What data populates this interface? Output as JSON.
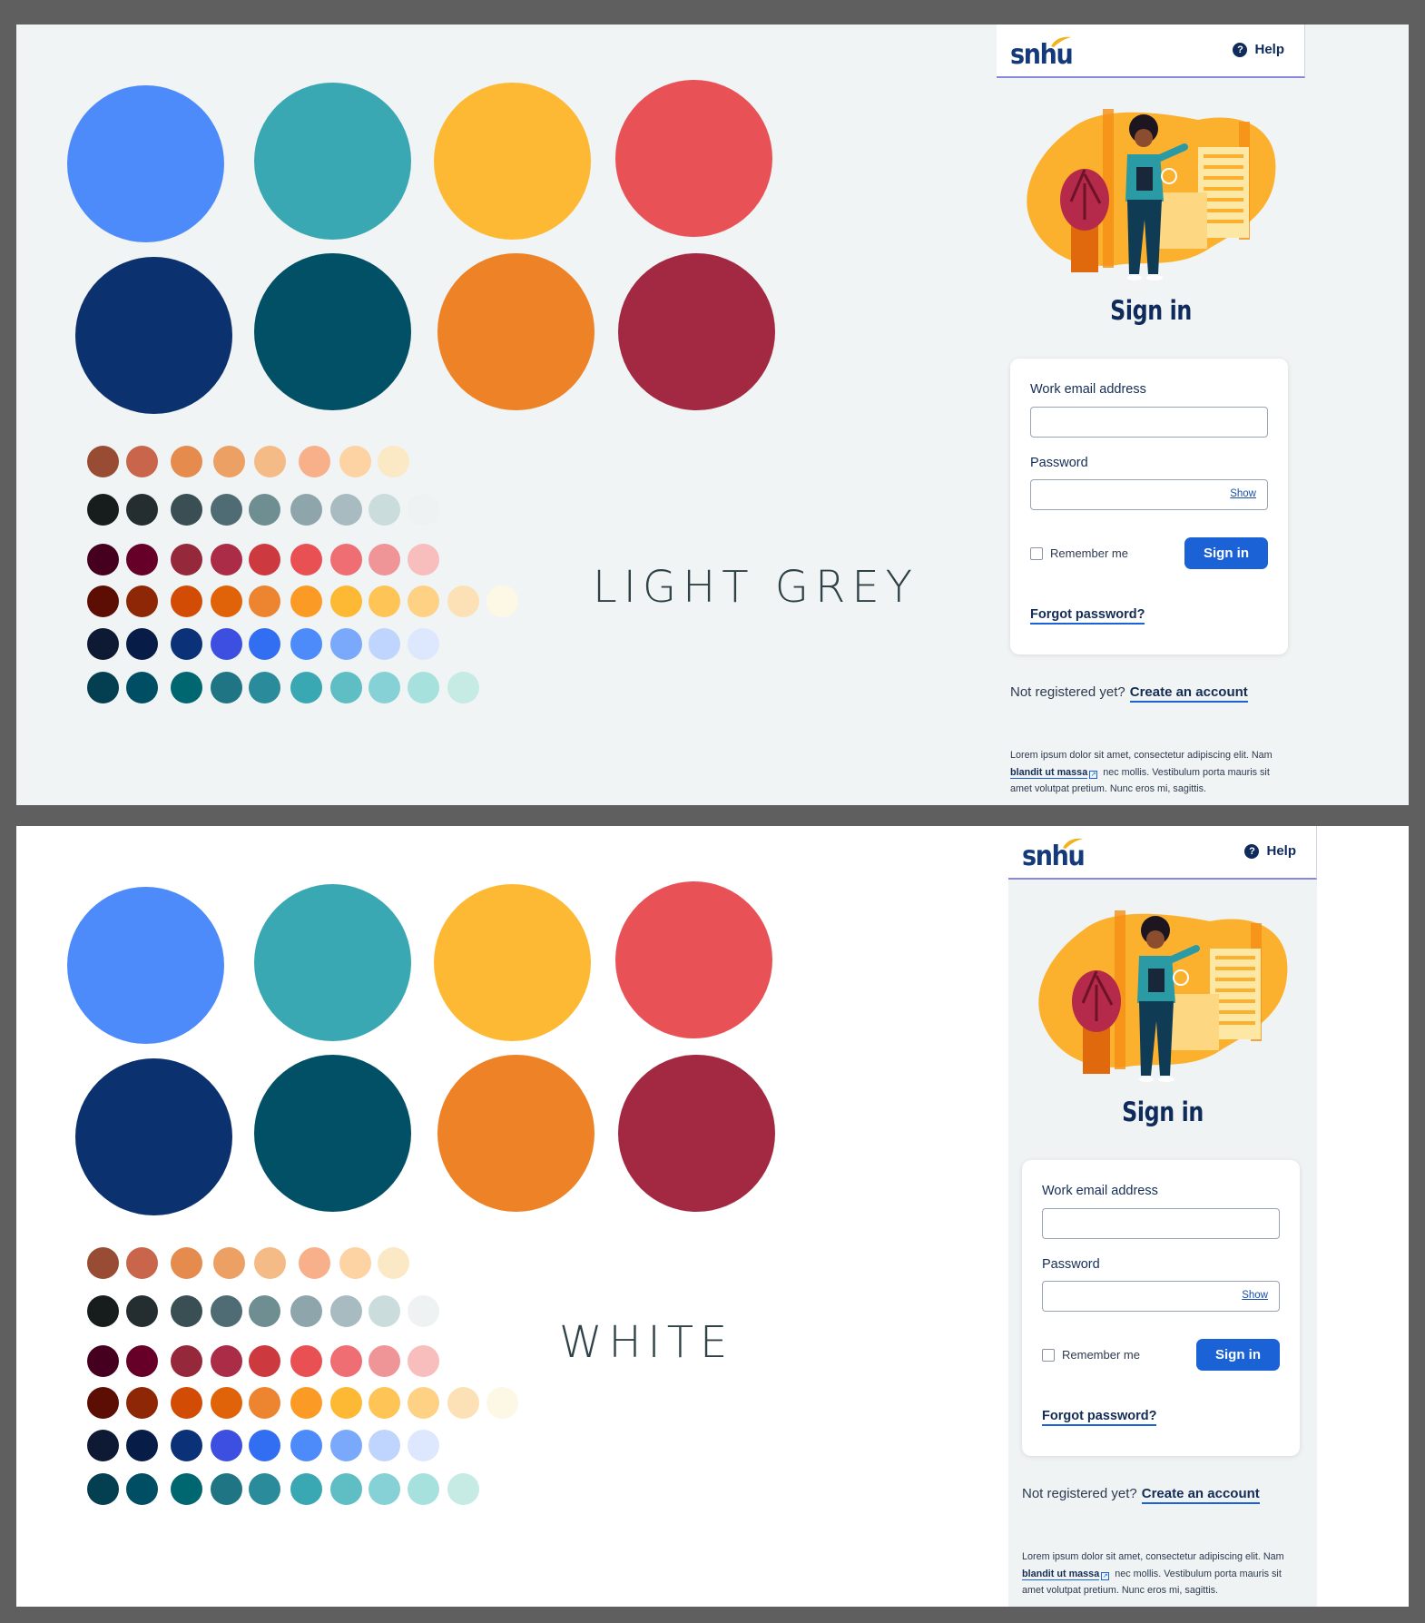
{
  "palette": {
    "primary": [
      "#4e8bfa",
      "#3aa8b3",
      "#fdb933",
      "#e85256"
    ],
    "primary_dark": [
      "#0c316f",
      "#015066",
      "#ed8226",
      "#a32842"
    ],
    "swatch_rows": [
      [
        "#974c33",
        "#c8654a",
        "#e58b4e",
        "#eca064",
        "#f5bb86",
        "#f8b08a",
        "#fdd3a3",
        "#fbe9c6"
      ],
      [
        "#171c1d",
        "#242e30",
        "#3a4f53",
        "#4f6c75",
        "#6e8e92",
        "#8ea6ab",
        "#a8bbc0",
        "#cadcdc",
        "#eef2f3"
      ],
      [
        "#45001f",
        "#660029",
        "#95283a",
        "#aa2c47",
        "#cc393f",
        "#e95054",
        "#ef6e73",
        "#ef9597",
        "#f8bdbd"
      ],
      [
        "#5c0e05",
        "#8e2705",
        "#d34c05",
        "#e06309",
        "#ed8530",
        "#fb9b26",
        "#fdb933",
        "#ffc456",
        "#ffd185",
        "#fce1b7",
        "#fdf8e6"
      ],
      [
        "#0e1a33",
        "#071c47",
        "#0b3278",
        "#3c4fe0",
        "#326ef1",
        "#4e8bfa",
        "#7aa9fb",
        "#c0d5fd",
        "#dde8fe"
      ],
      [
        "#033f51",
        "#004e64",
        "#006670",
        "#1f7584",
        "#2a8b9b",
        "#3aa8b3",
        "#5fbec4",
        "#85d1d5",
        "#a7e1dd",
        "#c6ebe4"
      ]
    ]
  },
  "panels": [
    {
      "label": "LIGHT GREY",
      "login": {
        "logo": "snhu",
        "help": "Help",
        "title": "Sign in",
        "email_label": "Work email address",
        "password_label": "Password",
        "show": "Show",
        "remember": "Remember me",
        "button": "Sign in",
        "forgot": "Forgot password?",
        "not_registered": "Not registered yet?",
        "create": "Create an account",
        "lorem_1": "Lorem ipsum dolor sit amet, consectetur adipiscing elit. Nam",
        "lorem_link": "blandit ut massa",
        "lorem_2": "nec mollis. Vestibulum porta mauris sit amet volutpat pretium. Nunc eros mi, sagittis."
      }
    },
    {
      "label": "WHITE",
      "login": {
        "logo": "snhu",
        "help": "Help",
        "title": "Sign in",
        "email_label": "Work email address",
        "password_label": "Password",
        "show": "Show",
        "remember": "Remember me",
        "button": "Sign in",
        "forgot": "Forgot password?",
        "not_registered": "Not registered yet?",
        "create": "Create an account",
        "lorem_1": "Lorem ipsum dolor sit amet, consectetur adipiscing elit. Nam",
        "lorem_link": "blandit ut massa",
        "lorem_2": "nec mollis. Vestibulum porta mauris sit amet volutpat pretium. Nunc eros mi, sagittis."
      }
    }
  ]
}
